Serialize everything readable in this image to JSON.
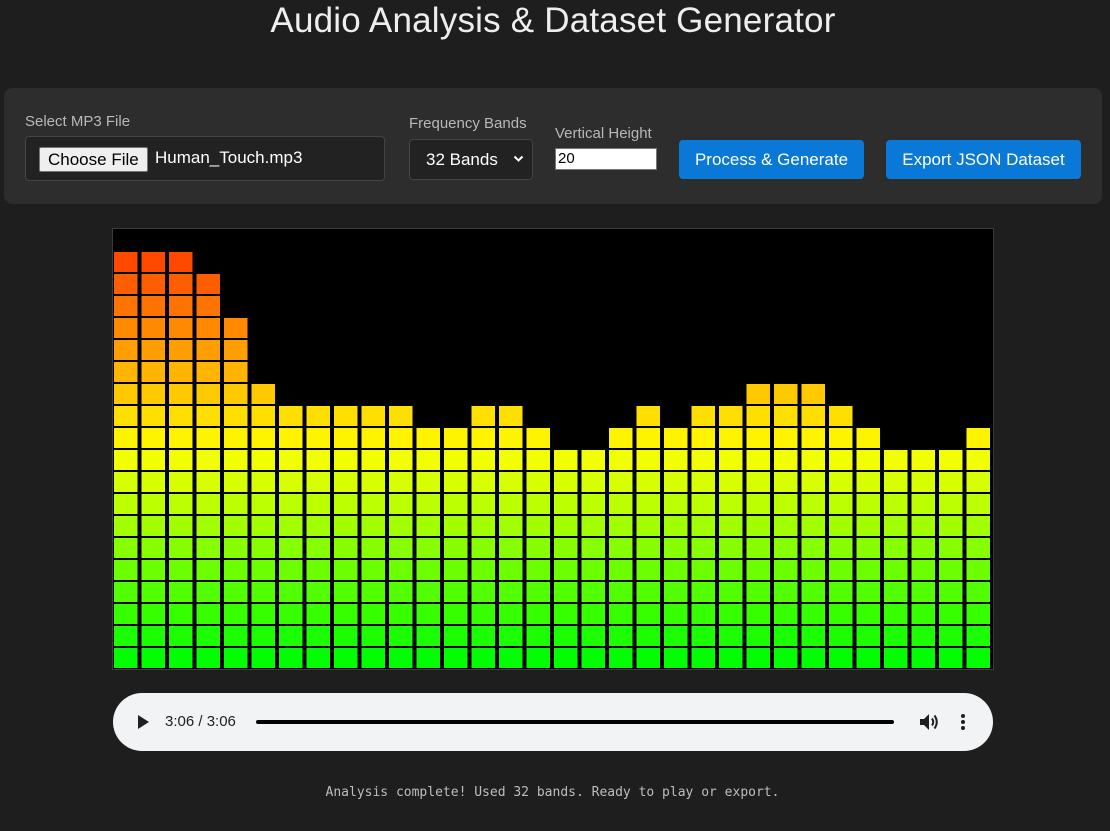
{
  "header": {
    "title": "Audio Analysis & Dataset Generator"
  },
  "controls": {
    "file_label": "Select MP3 File",
    "choose_file_label": "Choose File",
    "file_name": "Human_Touch.mp3",
    "bands_label": "Frequency Bands",
    "bands_selected": "32 Bands",
    "height_label": "Vertical Height",
    "height_value": "20",
    "process_label": "Process & Generate",
    "export_label": "Export JSON Dataset"
  },
  "visualizer": {
    "band_count": 32,
    "max_segments": 20,
    "band_levels": [
      19,
      19,
      19,
      18,
      16,
      13,
      12,
      12,
      12,
      12,
      12,
      11,
      11,
      12,
      12,
      11,
      10,
      10,
      11,
      12,
      11,
      12,
      12,
      13,
      13,
      13,
      12,
      11,
      10,
      10,
      10,
      11
    ],
    "colors": {
      "low": "#00ff00",
      "mid": "#ffff00",
      "high": "#ff3300",
      "background": "#000000"
    }
  },
  "player": {
    "time": "3:06 / 3:06",
    "progress_fraction": 1.0,
    "play_icon": "play-icon",
    "volume_icon": "volume-icon",
    "more_icon": "more-vertical-icon"
  },
  "status": {
    "message": "Analysis complete! Used 32 bands. Ready to play or export."
  },
  "theme": {
    "background": "#1e1e1e",
    "panel": "#2d2d2d",
    "accent": "#0a78d7"
  }
}
